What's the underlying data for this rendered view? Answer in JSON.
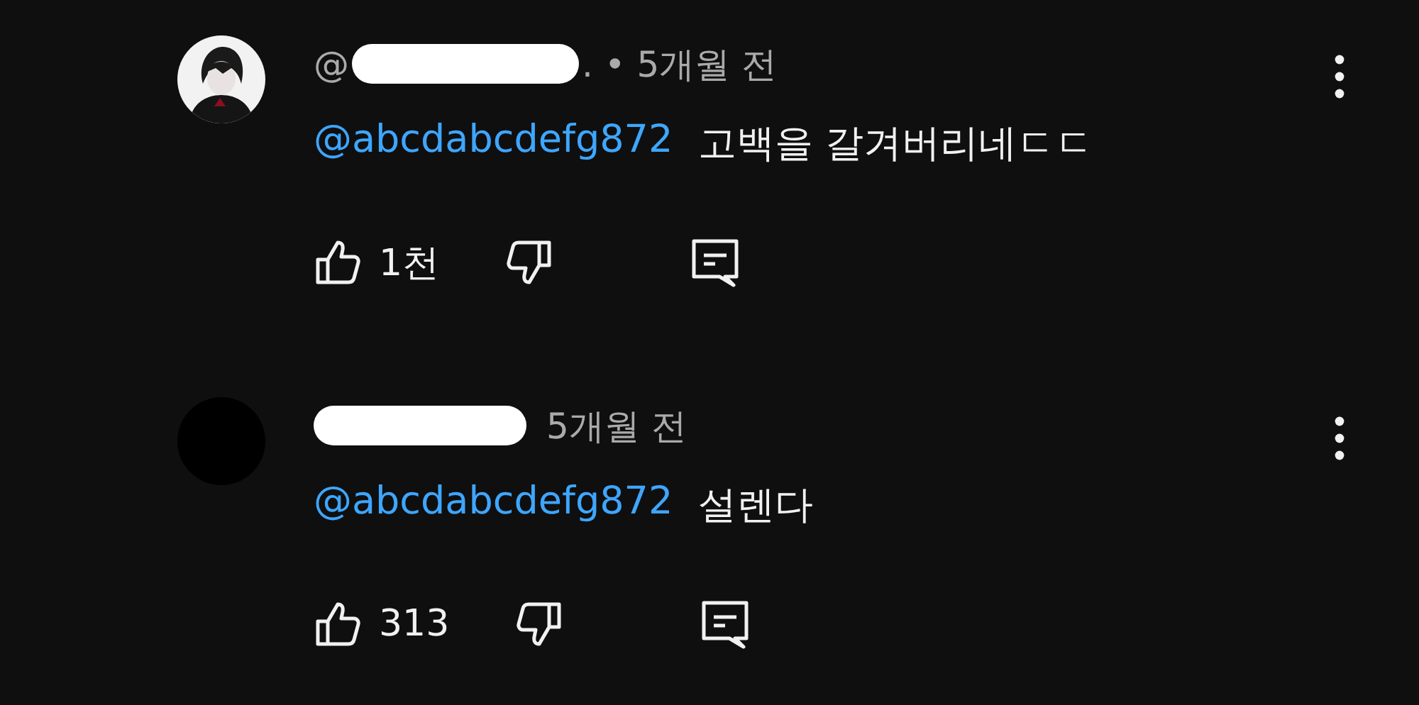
{
  "comments": [
    {
      "author_prefix": "@",
      "redacted": true,
      "author_suffix": ".",
      "separator": "•",
      "time": "5개월 전",
      "mention": "@abcdabcdefg872",
      "text": "고백을 갈겨버리네ㄷㄷ",
      "likes": "1천"
    },
    {
      "avatar": {
        "kind": "blank"
      },
      "redacted": true,
      "time": "5개월 전",
      "mention": "@abcdabcdefg872",
      "text": "설렌다",
      "likes": "313"
    }
  ]
}
